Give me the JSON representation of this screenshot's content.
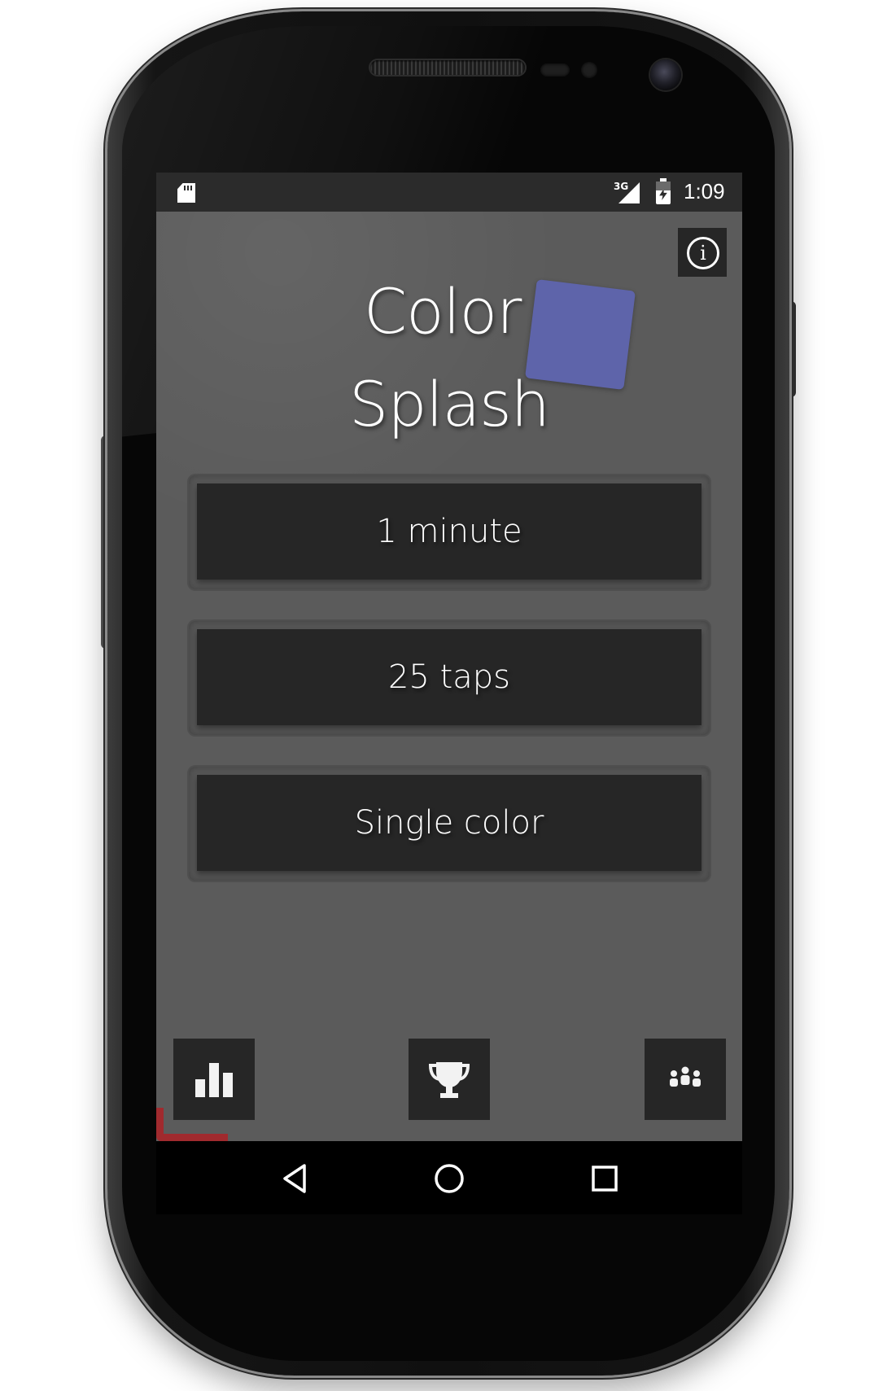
{
  "status_bar": {
    "network_label": "3G",
    "time": "1:09",
    "icons": [
      "sd-card-icon",
      "signal-icon",
      "battery-charging-icon"
    ]
  },
  "app": {
    "title_line1": "Color",
    "title_line2": "Splash",
    "accent_square_color": "#5e64aa",
    "background_color": "#5b5b5b",
    "button_color": "#262626",
    "accent_corner_color": "#a02a2e",
    "info_glyph": "i",
    "modes": [
      {
        "label": "1 minute"
      },
      {
        "label": "25 taps"
      },
      {
        "label": "Single color"
      }
    ],
    "bottom_icons": [
      "bar-chart-icon",
      "trophy-icon",
      "people-icon"
    ]
  },
  "nav_bar": {
    "icons": [
      "back-icon",
      "home-icon",
      "recents-icon"
    ]
  }
}
